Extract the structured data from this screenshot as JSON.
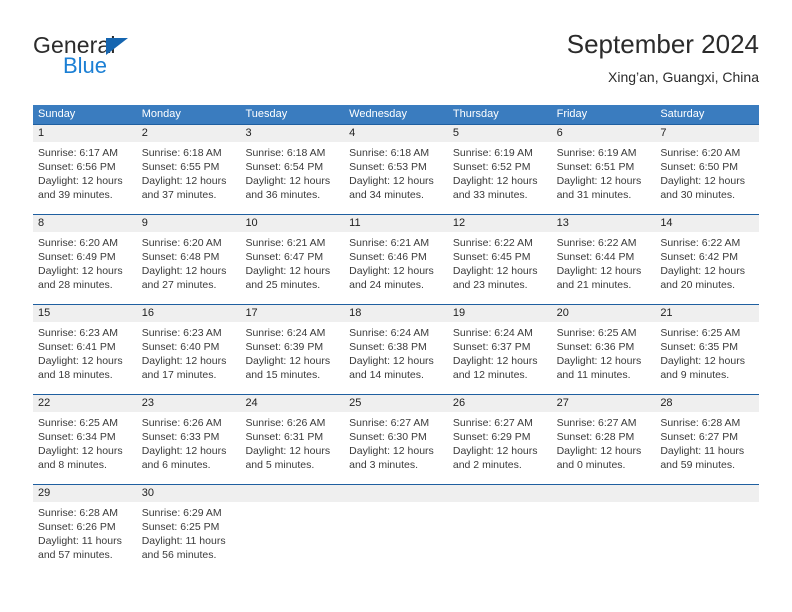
{
  "brand": {
    "name_part1": "General",
    "name_part2": "Blue",
    "triangle_icon": "triangle-logo-icon"
  },
  "header": {
    "title": "September 2024",
    "subtitle": "Xing’an, Guangxi, China"
  },
  "colors": {
    "header_blue": "#3a7cbf",
    "rule_blue": "#1f5fa0",
    "daynum_gray": "#efefef",
    "brand_blue": "#1b7fd4",
    "brand_dark": "#2b2b2b"
  },
  "weekdays": [
    "Sunday",
    "Monday",
    "Tuesday",
    "Wednesday",
    "Thursday",
    "Friday",
    "Saturday"
  ],
  "weeks": [
    {
      "numbers": [
        "1",
        "2",
        "3",
        "4",
        "5",
        "6",
        "7"
      ],
      "cells": [
        {
          "sunrise": "Sunrise: 6:17 AM",
          "sunset": "Sunset: 6:56 PM",
          "daylight1": "Daylight: 12 hours",
          "daylight2": "and 39 minutes."
        },
        {
          "sunrise": "Sunrise: 6:18 AM",
          "sunset": "Sunset: 6:55 PM",
          "daylight1": "Daylight: 12 hours",
          "daylight2": "and 37 minutes."
        },
        {
          "sunrise": "Sunrise: 6:18 AM",
          "sunset": "Sunset: 6:54 PM",
          "daylight1": "Daylight: 12 hours",
          "daylight2": "and 36 minutes."
        },
        {
          "sunrise": "Sunrise: 6:18 AM",
          "sunset": "Sunset: 6:53 PM",
          "daylight1": "Daylight: 12 hours",
          "daylight2": "and 34 minutes."
        },
        {
          "sunrise": "Sunrise: 6:19 AM",
          "sunset": "Sunset: 6:52 PM",
          "daylight1": "Daylight: 12 hours",
          "daylight2": "and 33 minutes."
        },
        {
          "sunrise": "Sunrise: 6:19 AM",
          "sunset": "Sunset: 6:51 PM",
          "daylight1": "Daylight: 12 hours",
          "daylight2": "and 31 minutes."
        },
        {
          "sunrise": "Sunrise: 6:20 AM",
          "sunset": "Sunset: 6:50 PM",
          "daylight1": "Daylight: 12 hours",
          "daylight2": "and 30 minutes."
        }
      ]
    },
    {
      "numbers": [
        "8",
        "9",
        "10",
        "11",
        "12",
        "13",
        "14"
      ],
      "cells": [
        {
          "sunrise": "Sunrise: 6:20 AM",
          "sunset": "Sunset: 6:49 PM",
          "daylight1": "Daylight: 12 hours",
          "daylight2": "and 28 minutes."
        },
        {
          "sunrise": "Sunrise: 6:20 AM",
          "sunset": "Sunset: 6:48 PM",
          "daylight1": "Daylight: 12 hours",
          "daylight2": "and 27 minutes."
        },
        {
          "sunrise": "Sunrise: 6:21 AM",
          "sunset": "Sunset: 6:47 PM",
          "daylight1": "Daylight: 12 hours",
          "daylight2": "and 25 minutes."
        },
        {
          "sunrise": "Sunrise: 6:21 AM",
          "sunset": "Sunset: 6:46 PM",
          "daylight1": "Daylight: 12 hours",
          "daylight2": "and 24 minutes."
        },
        {
          "sunrise": "Sunrise: 6:22 AM",
          "sunset": "Sunset: 6:45 PM",
          "daylight1": "Daylight: 12 hours",
          "daylight2": "and 23 minutes."
        },
        {
          "sunrise": "Sunrise: 6:22 AM",
          "sunset": "Sunset: 6:44 PM",
          "daylight1": "Daylight: 12 hours",
          "daylight2": "and 21 minutes."
        },
        {
          "sunrise": "Sunrise: 6:22 AM",
          "sunset": "Sunset: 6:42 PM",
          "daylight1": "Daylight: 12 hours",
          "daylight2": "and 20 minutes."
        }
      ]
    },
    {
      "numbers": [
        "15",
        "16",
        "17",
        "18",
        "19",
        "20",
        "21"
      ],
      "cells": [
        {
          "sunrise": "Sunrise: 6:23 AM",
          "sunset": "Sunset: 6:41 PM",
          "daylight1": "Daylight: 12 hours",
          "daylight2": "and 18 minutes."
        },
        {
          "sunrise": "Sunrise: 6:23 AM",
          "sunset": "Sunset: 6:40 PM",
          "daylight1": "Daylight: 12 hours",
          "daylight2": "and 17 minutes."
        },
        {
          "sunrise": "Sunrise: 6:24 AM",
          "sunset": "Sunset: 6:39 PM",
          "daylight1": "Daylight: 12 hours",
          "daylight2": "and 15 minutes."
        },
        {
          "sunrise": "Sunrise: 6:24 AM",
          "sunset": "Sunset: 6:38 PM",
          "daylight1": "Daylight: 12 hours",
          "daylight2": "and 14 minutes."
        },
        {
          "sunrise": "Sunrise: 6:24 AM",
          "sunset": "Sunset: 6:37 PM",
          "daylight1": "Daylight: 12 hours",
          "daylight2": "and 12 minutes."
        },
        {
          "sunrise": "Sunrise: 6:25 AM",
          "sunset": "Sunset: 6:36 PM",
          "daylight1": "Daylight: 12 hours",
          "daylight2": "and 11 minutes."
        },
        {
          "sunrise": "Sunrise: 6:25 AM",
          "sunset": "Sunset: 6:35 PM",
          "daylight1": "Daylight: 12 hours",
          "daylight2": "and 9 minutes."
        }
      ]
    },
    {
      "numbers": [
        "22",
        "23",
        "24",
        "25",
        "26",
        "27",
        "28"
      ],
      "cells": [
        {
          "sunrise": "Sunrise: 6:25 AM",
          "sunset": "Sunset: 6:34 PM",
          "daylight1": "Daylight: 12 hours",
          "daylight2": "and 8 minutes."
        },
        {
          "sunrise": "Sunrise: 6:26 AM",
          "sunset": "Sunset: 6:33 PM",
          "daylight1": "Daylight: 12 hours",
          "daylight2": "and 6 minutes."
        },
        {
          "sunrise": "Sunrise: 6:26 AM",
          "sunset": "Sunset: 6:31 PM",
          "daylight1": "Daylight: 12 hours",
          "daylight2": "and 5 minutes."
        },
        {
          "sunrise": "Sunrise: 6:27 AM",
          "sunset": "Sunset: 6:30 PM",
          "daylight1": "Daylight: 12 hours",
          "daylight2": "and 3 minutes."
        },
        {
          "sunrise": "Sunrise: 6:27 AM",
          "sunset": "Sunset: 6:29 PM",
          "daylight1": "Daylight: 12 hours",
          "daylight2": "and 2 minutes."
        },
        {
          "sunrise": "Sunrise: 6:27 AM",
          "sunset": "Sunset: 6:28 PM",
          "daylight1": "Daylight: 12 hours",
          "daylight2": "and 0 minutes."
        },
        {
          "sunrise": "Sunrise: 6:28 AM",
          "sunset": "Sunset: 6:27 PM",
          "daylight1": "Daylight: 11 hours",
          "daylight2": "and 59 minutes."
        }
      ]
    },
    {
      "numbers": [
        "29",
        "30",
        "",
        "",
        "",
        "",
        ""
      ],
      "cells": [
        {
          "sunrise": "Sunrise: 6:28 AM",
          "sunset": "Sunset: 6:26 PM",
          "daylight1": "Daylight: 11 hours",
          "daylight2": "and 57 minutes."
        },
        {
          "sunrise": "Sunrise: 6:29 AM",
          "sunset": "Sunset: 6:25 PM",
          "daylight1": "Daylight: 11 hours",
          "daylight2": "and 56 minutes."
        },
        {
          "sunrise": "",
          "sunset": "",
          "daylight1": "",
          "daylight2": ""
        },
        {
          "sunrise": "",
          "sunset": "",
          "daylight1": "",
          "daylight2": ""
        },
        {
          "sunrise": "",
          "sunset": "",
          "daylight1": "",
          "daylight2": ""
        },
        {
          "sunrise": "",
          "sunset": "",
          "daylight1": "",
          "daylight2": ""
        },
        {
          "sunrise": "",
          "sunset": "",
          "daylight1": "",
          "daylight2": ""
        }
      ]
    }
  ]
}
